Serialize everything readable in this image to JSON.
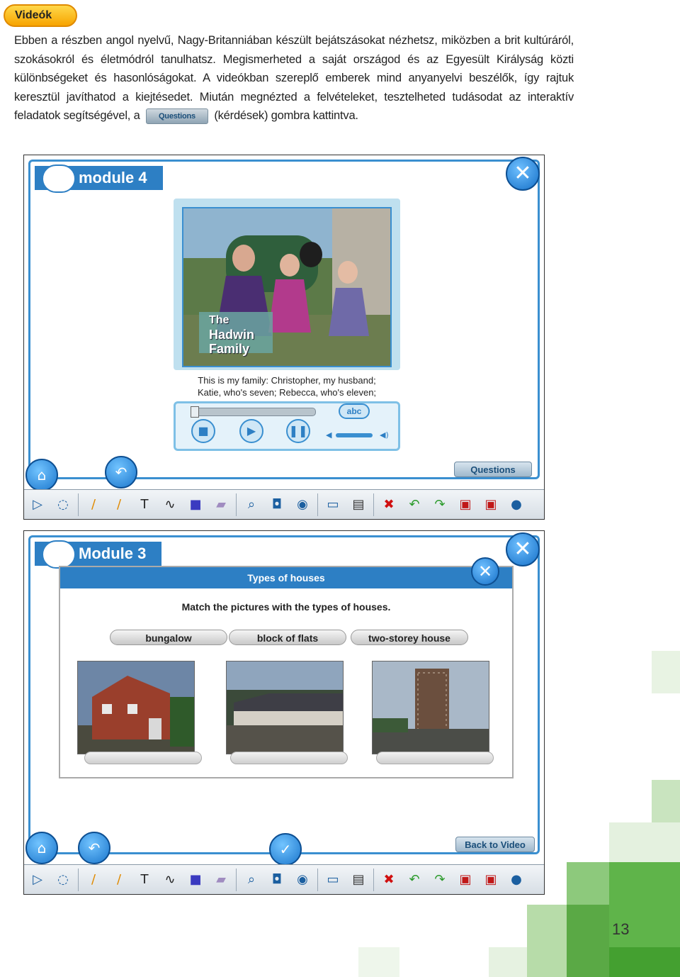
{
  "section_tag": "Videók",
  "intro": {
    "before_button": "Ebben a részben angol nyelvű, Nagy-Britanniában készült bejátszásokat nézhetsz, miközben a brit kultúráról, szokásokról és életmódról tanulhatsz. Megismerheted a saját országod és az Egyesült Királyság közti különbségeket és hasonlóságokat. A videókban szereplő emberek mind anyanyelvi beszélők, így rajtuk keresztül javíthatod a kiejtésedet. Miután megnézted a felvételeket, tesztelheted tudásodat az interaktív feladatok segítségével, a",
    "inline_button": "Questions",
    "after_button": "(kérdések) gombra kattintva."
  },
  "screenshot1": {
    "module_title": "module 4",
    "close": "✕",
    "video_title_lines": [
      "The",
      "Hadwin",
      "Family"
    ],
    "caption_lines": [
      "This is my family: Christopher, my husband;",
      "Katie, who's seven; Rebecca, who's eleven;"
    ],
    "abc_label": "abc",
    "questions_button": "Questions"
  },
  "screenshot2": {
    "module_title": "Module 3",
    "close": "✕",
    "panel_title": "Types of houses",
    "instruction": "Match the pictures with the types of houses.",
    "labels": [
      "bungalow",
      "block of flats",
      "two-storey house"
    ],
    "back_button": "Back to Video"
  },
  "toolbar_icons": [
    "play-icon",
    "lasso-icon",
    "pencil-icon",
    "highlighter-icon",
    "text-icon",
    "curve-icon",
    "shape-icon",
    "eraser-icon",
    "magnifier-icon",
    "camera-icon",
    "eye-icon",
    "screen-icon",
    "print-icon",
    "clear-icon",
    "undo-icon",
    "redo-icon",
    "save-icon",
    "save-as-icon",
    "globe-icon"
  ],
  "page_number": "13"
}
